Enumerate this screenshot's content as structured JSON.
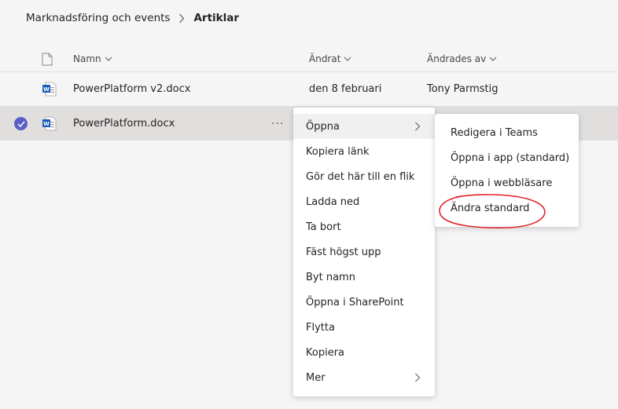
{
  "breadcrumb": {
    "parent": "Marknadsföring och events",
    "current": "Artiklar"
  },
  "columns": {
    "name": "Namn",
    "modified": "Ändrat",
    "modified_by": "Ändrades av"
  },
  "files": [
    {
      "name": "PowerPlatform v2.docx",
      "modified": "den 8 februari",
      "modified_by": "Tony Parmstig",
      "icon": "word-doc-icon"
    },
    {
      "name": "PowerPlatform.docx",
      "more": "···",
      "icon": "word-doc-icon"
    }
  ],
  "context_menu": {
    "items": [
      "Öppna",
      "Kopiera länk",
      "Gör det här till en flik",
      "Ladda ned",
      "Ta bort",
      "Fäst högst upp",
      "Byt namn",
      "Öppna i SharePoint",
      "Flytta",
      "Kopiera",
      "Mer"
    ]
  },
  "submenu": {
    "items": [
      "Redigera i Teams",
      "Öppna i app (standard)",
      "Öppna i webbläsare",
      "Ändra standard"
    ]
  },
  "colors": {
    "accent": "#5b5fc7",
    "word": "#185abd",
    "annotation": "#e3242b"
  }
}
